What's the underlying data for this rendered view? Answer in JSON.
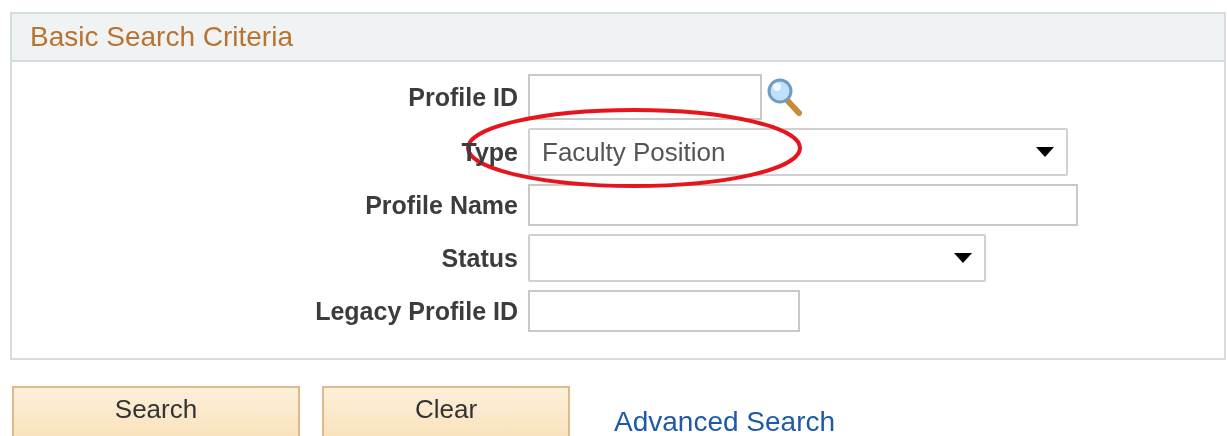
{
  "panel": {
    "title": "Basic Search Criteria"
  },
  "fields": [
    {
      "label": "Profile ID",
      "kind": "lookup"
    },
    {
      "label": "Type",
      "kind": "select",
      "value": "Faculty Position"
    },
    {
      "label": "Profile Name",
      "kind": "text"
    },
    {
      "label": "Status",
      "kind": "select"
    },
    {
      "label": "Legacy Profile ID",
      "kind": "text"
    }
  ],
  "buttons": [
    "Search",
    "Clear"
  ],
  "link": "Advanced Search"
}
